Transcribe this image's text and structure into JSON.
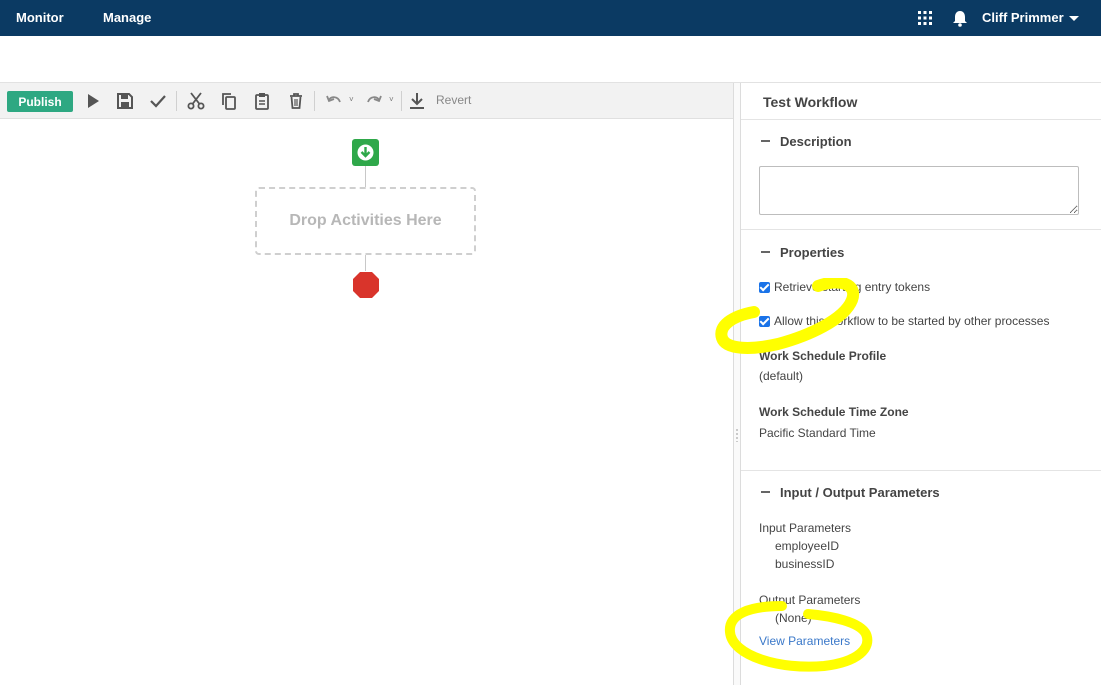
{
  "nav": {
    "items": [
      "Monitor",
      "Manage"
    ],
    "user_name": "Cliff Primmer"
  },
  "toolbar": {
    "publish_label": "Publish",
    "revert_label": "Revert"
  },
  "canvas": {
    "drop_zone_label": "Drop Activities Here"
  },
  "panel": {
    "title": "Test Workflow",
    "description": {
      "heading": "Description",
      "value": ""
    },
    "properties": {
      "heading": "Properties",
      "checkboxes": [
        {
          "label": "Retrieve starting entry tokens",
          "checked": true
        },
        {
          "label": "Allow this workflow to be started by other processes",
          "checked": true
        }
      ],
      "work_schedule_profile_label": "Work Schedule Profile",
      "work_schedule_profile_value": "(default)",
      "work_schedule_tz_label": "Work Schedule Time Zone",
      "work_schedule_tz_value": "Pacific Standard Time"
    },
    "io": {
      "heading": "Input / Output Parameters",
      "input_label": "Input Parameters",
      "inputs": [
        "employeeID",
        "businessID"
      ],
      "output_label": "Output Parameters",
      "outputs": [
        "(None)"
      ],
      "view_link": "View Parameters"
    }
  },
  "colors": {
    "nav_bg": "#0b3a63",
    "publish_bg": "#2ea882",
    "start_node": "#2fa84a",
    "end_node": "#d9342b",
    "link": "#3a78c9",
    "highlight": "#ffff00"
  }
}
